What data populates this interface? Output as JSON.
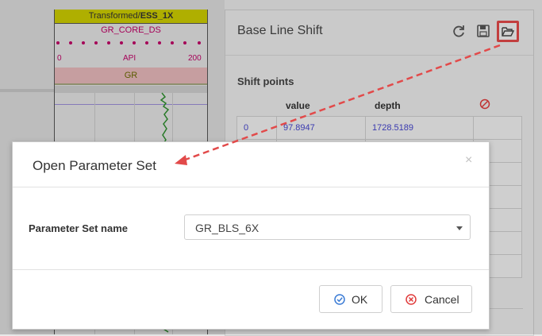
{
  "track": {
    "header_prefix": "Transformed/",
    "header_bold": "ESS_1X",
    "curve_name": "GR_CORE_DS",
    "scale_min": "0",
    "scale_unit": "API",
    "scale_max": "200",
    "band_label": "GR"
  },
  "panel": {
    "title": "Base Line Shift",
    "section_title": "Shift points",
    "columns": {
      "value": "value",
      "depth": "depth"
    },
    "rows": [
      {
        "index": "0",
        "value": "97.8947",
        "depth": "1728.5189"
      }
    ]
  },
  "modal": {
    "title": "Open Parameter Set",
    "close": "×",
    "field_label": "Parameter Set name",
    "selected_value": "GR_BLS_6X",
    "ok_label": "OK",
    "cancel_label": "Cancel"
  },
  "colors": {
    "highlight": "#e24a4a",
    "curve": "#c00066",
    "header_bg": "#cccc00"
  }
}
